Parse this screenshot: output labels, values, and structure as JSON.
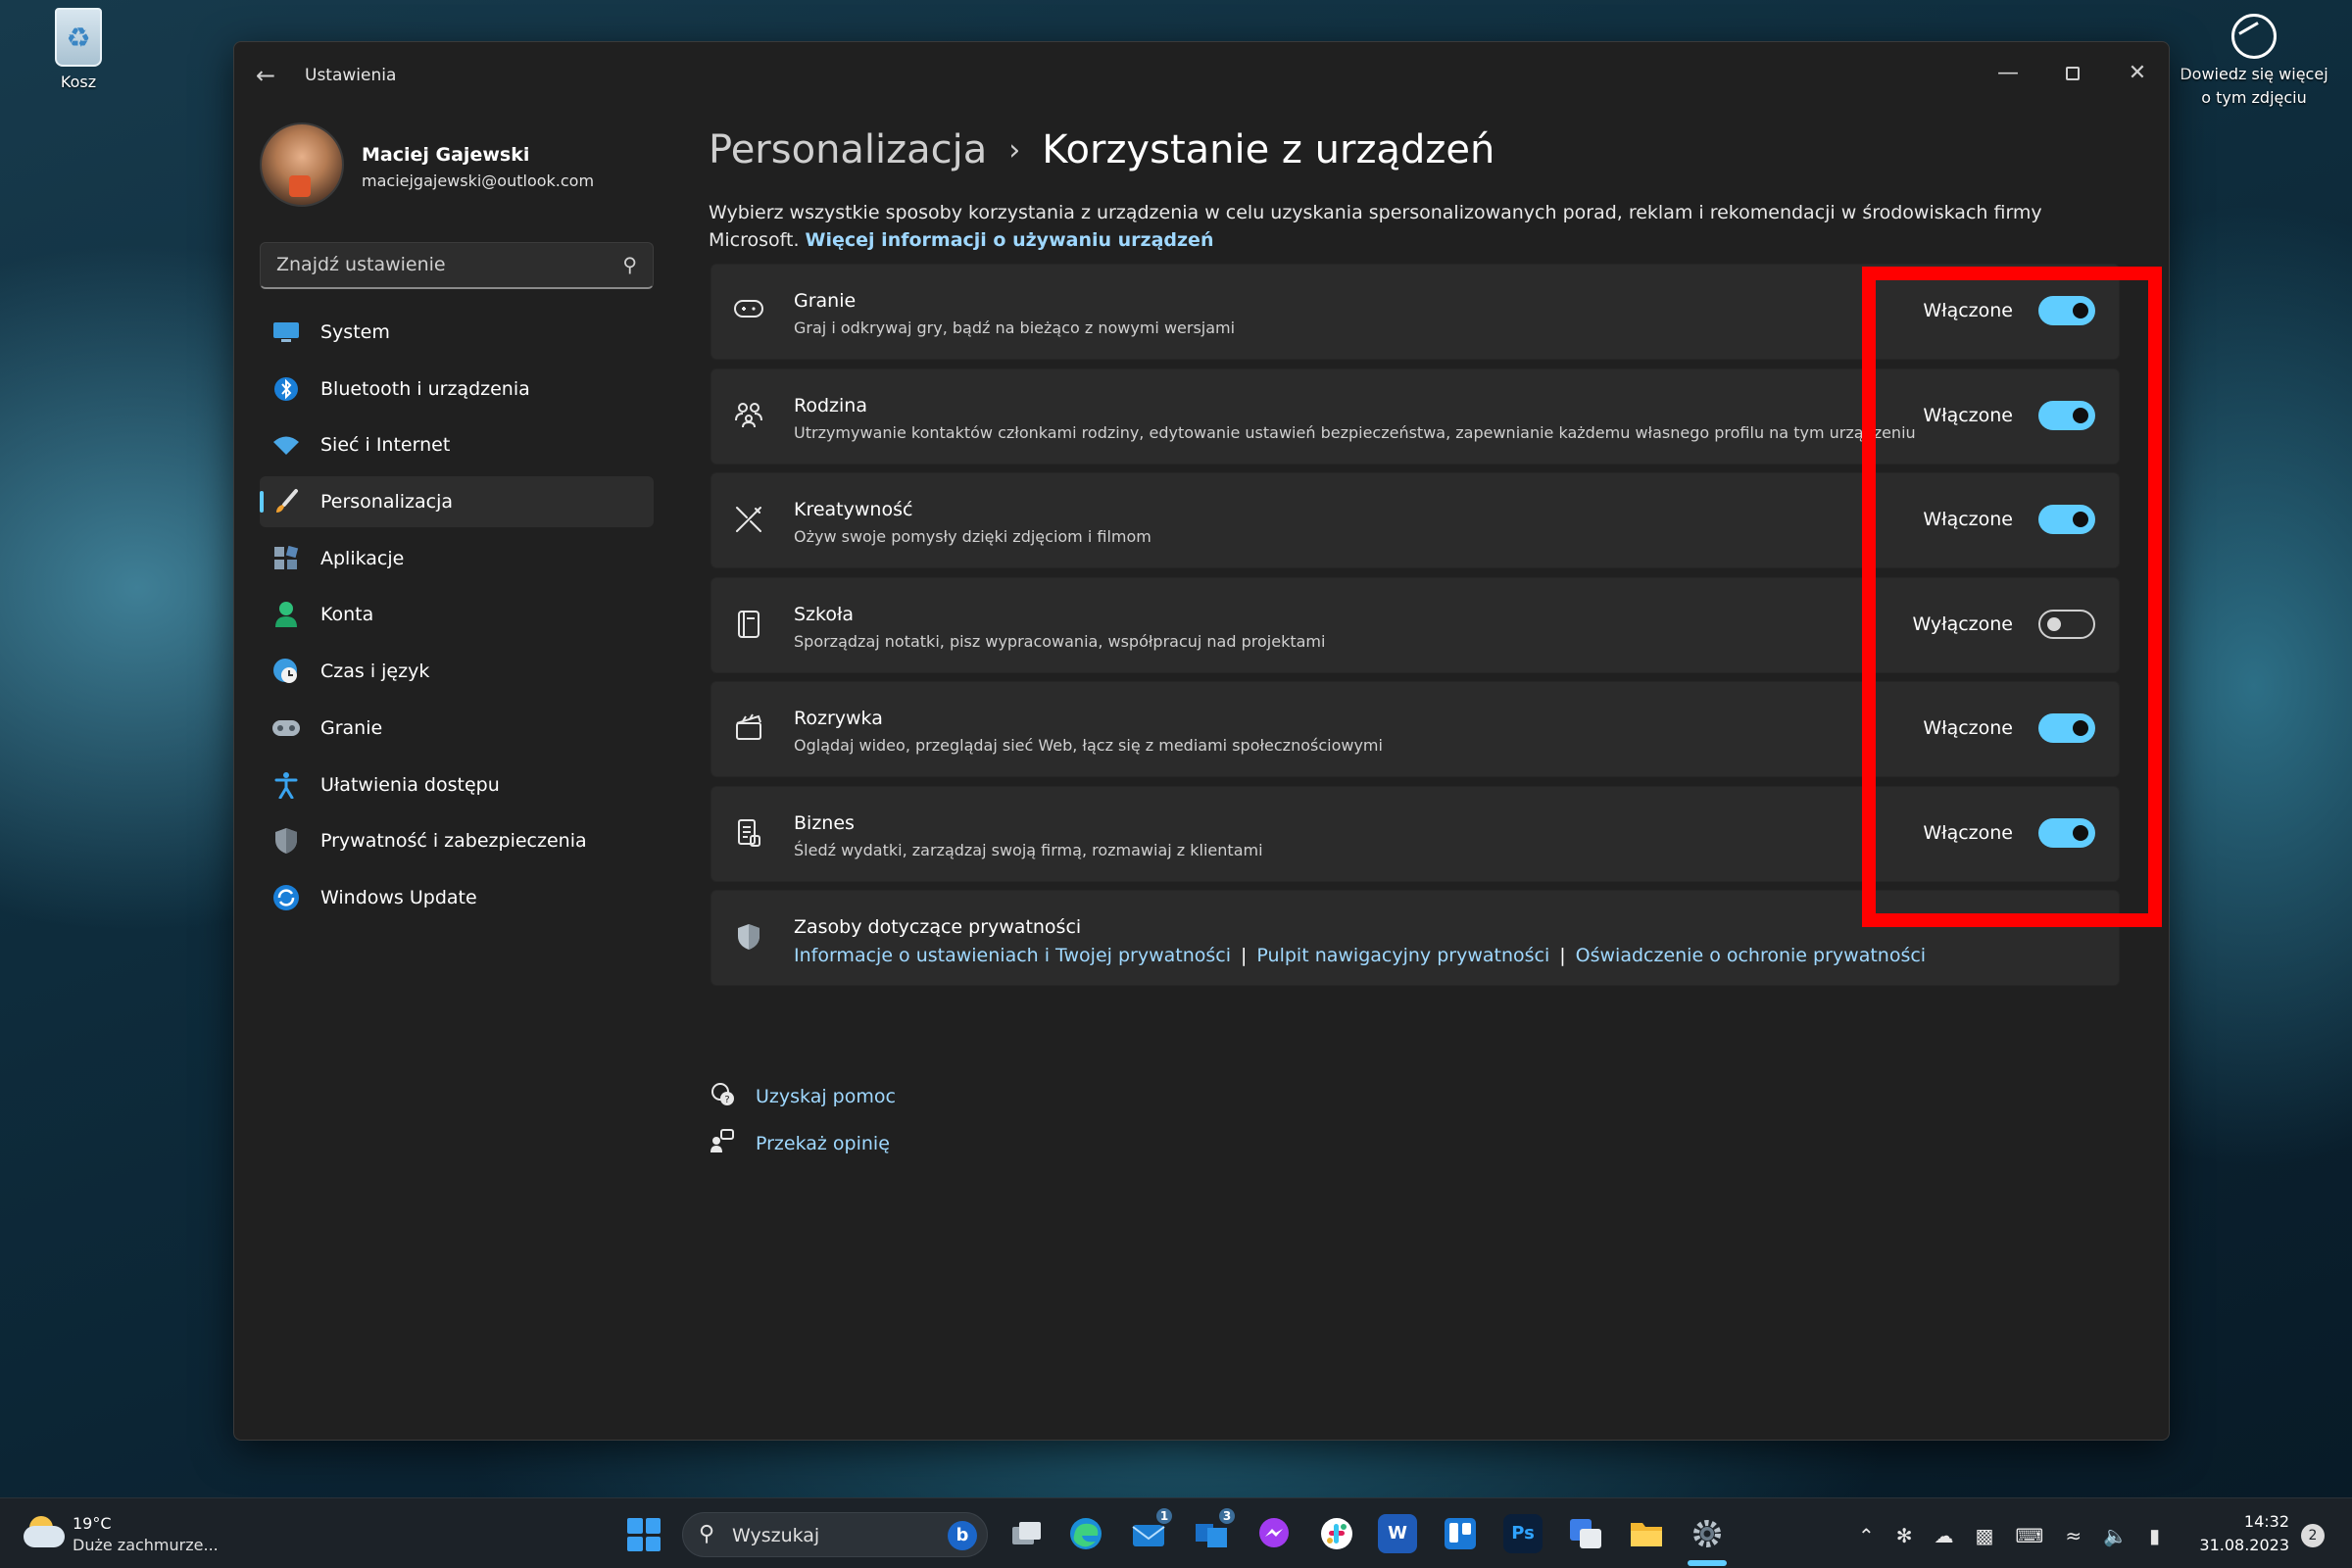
{
  "desktop": {
    "recycle_bin": "Kosz",
    "learn_more": "Dowiedz się więcej o tym zdjęciu"
  },
  "window": {
    "title": "Ustawienia",
    "controls": {
      "minimize": "—",
      "close": "✕"
    }
  },
  "profile": {
    "name": "Maciej Gajewski",
    "email": "maciejgajewski@outlook.com"
  },
  "search": {
    "placeholder": "Znajdź ustawienie"
  },
  "sidebar": {
    "items": [
      {
        "label": "System",
        "icon": "monitor-icon"
      },
      {
        "label": "Bluetooth i urządzenia",
        "icon": "bluetooth-icon"
      },
      {
        "label": "Sieć i Internet",
        "icon": "wifi-icon"
      },
      {
        "label": "Personalizacja",
        "icon": "brush-icon",
        "active": true
      },
      {
        "label": "Aplikacje",
        "icon": "apps-icon"
      },
      {
        "label": "Konta",
        "icon": "person-icon"
      },
      {
        "label": "Czas i język",
        "icon": "globe-clock-icon"
      },
      {
        "label": "Granie",
        "icon": "gamepad-icon"
      },
      {
        "label": "Ułatwienia dostępu",
        "icon": "accessibility-icon"
      },
      {
        "label": "Prywatność i zabezpieczenia",
        "icon": "shield-icon"
      },
      {
        "label": "Windows Update",
        "icon": "update-icon"
      }
    ]
  },
  "breadcrumb": {
    "parent": "Personalizacja",
    "separator": "›",
    "current": "Korzystanie z urządzeń"
  },
  "description": {
    "text": "Wybierz wszystkie sposoby korzystania z urządzenia w celu uzyskania spersonalizowanych porad, reklam i rekomendacji w środowiskach firmy Microsoft. ",
    "link": "Więcej informacji o używaniu urządzeń"
  },
  "options": [
    {
      "title": "Granie",
      "subtitle": "Graj i odkrywaj gry, bądź na bieżąco z nowymi wersjami",
      "state": "Włączone",
      "on": true,
      "icon": "gamepad-icon"
    },
    {
      "title": "Rodzina",
      "subtitle": "Utrzymywanie kontaktów członkami rodziny, edytowanie ustawień bezpieczeństwa, zapewnianie każdemu własnego profilu na tym urządzeniu",
      "state": "Włączone",
      "on": true,
      "icon": "family-icon"
    },
    {
      "title": "Kreatywność",
      "subtitle": "Ożyw swoje pomysły dzięki zdjęciom i filmom",
      "state": "Włączone",
      "on": true,
      "icon": "creativity-icon"
    },
    {
      "title": "Szkoła",
      "subtitle": "Sporządzaj notatki, pisz wypracowania, współpracuj nad projektami",
      "state": "Wyłączone",
      "on": false,
      "icon": "notebook-icon"
    },
    {
      "title": "Rozrywka",
      "subtitle": "Oglądaj wideo, przeglądaj sieć Web, łącz się z mediami społecznościowymi",
      "state": "Włączone",
      "on": true,
      "icon": "clapperboard-icon"
    },
    {
      "title": "Biznes",
      "subtitle": "Śledź wydatki, zarządzaj swoją firmą, rozmawiaj z klientami",
      "state": "Włączone",
      "on": true,
      "icon": "document-icon"
    }
  ],
  "privacy": {
    "title": "Zasoby dotyczące prywatności",
    "links": [
      "Informacje o ustawieniach i Twojej prywatności",
      "Pulpit nawigacyjny prywatności",
      "Oświadczenie o ochronie prywatności"
    ],
    "separator": "|"
  },
  "help": {
    "get_help": "Uzyskaj pomoc",
    "feedback": "Przekaż opinię"
  },
  "taskbar": {
    "weather_temp": "19°C",
    "weather_cond": "Duże zachmurze...",
    "search_label": "Wyszukaj",
    "bing_letter": "b",
    "word_letter": "W",
    "ps_letter": "Ps",
    "mail_badge": "1",
    "todo_badge": "3",
    "time": "14:32",
    "date": "31.08.2023",
    "notifications": "2",
    "accent": "#60cdff"
  }
}
